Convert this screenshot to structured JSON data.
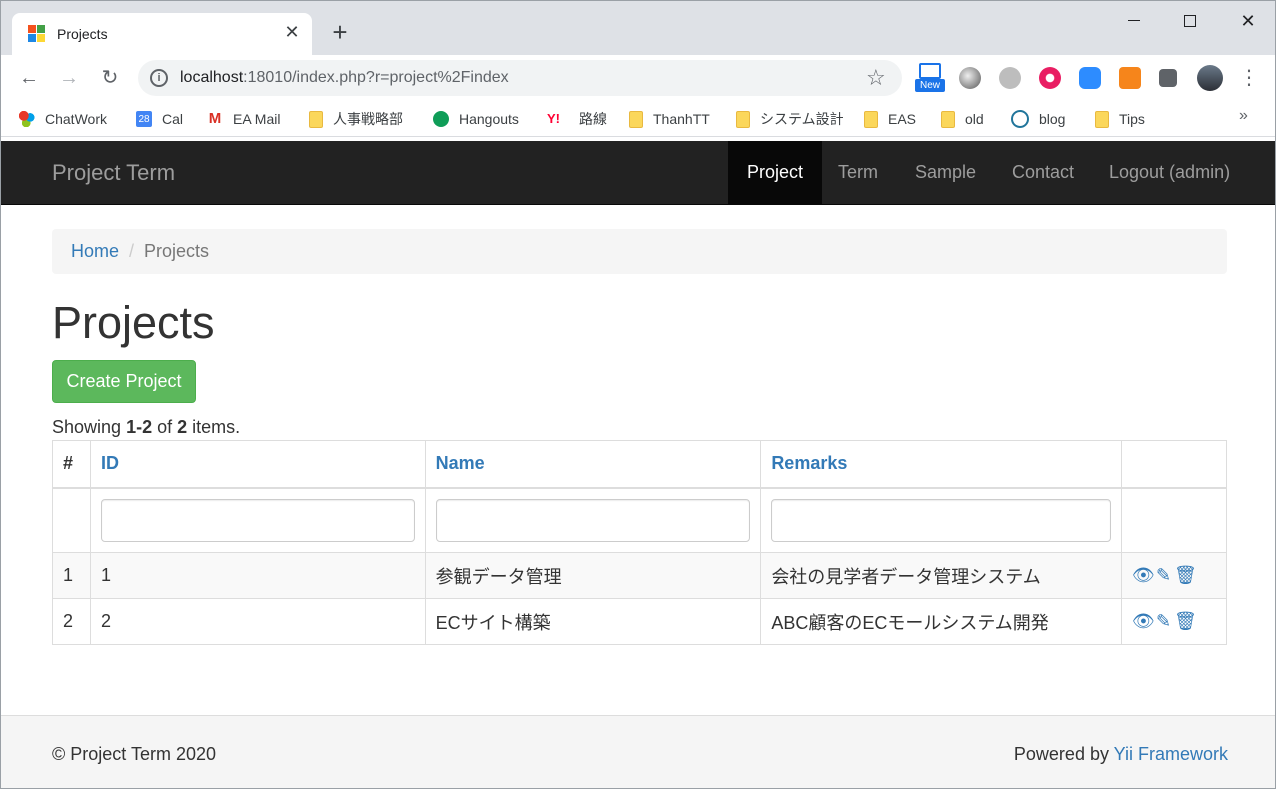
{
  "browser": {
    "tab": {
      "title": "Projects",
      "close_glyph": "✕"
    },
    "new_tab_glyph": "+",
    "window": {
      "close_glyph": "✕"
    },
    "nav": {
      "back_glyph": "←",
      "forward_glyph": "→",
      "reload_glyph": "↻"
    },
    "address": {
      "host": "localhost",
      "rest": ":18010/index.php?r=project%2Findex"
    },
    "extension_badge": "New",
    "bookmarks": [
      {
        "label": "ChatWork",
        "icon": "chatwork-icon"
      },
      {
        "label": "Cal",
        "icon": "calendar-icon",
        "icon_text": "28"
      },
      {
        "label": "EA Mail",
        "icon": "gmail-icon",
        "icon_text": "M"
      },
      {
        "label": "人事戦略部",
        "icon": "folder-icon"
      },
      {
        "label": "Hangouts",
        "icon": "hangouts-icon"
      },
      {
        "label": "路線",
        "icon": "yahoo-icon",
        "icon_text": "Y!"
      },
      {
        "label": "ThanhTT",
        "icon": "folder-icon"
      },
      {
        "label": "システム設計",
        "icon": "folder-icon"
      },
      {
        "label": "EAS",
        "icon": "folder-icon"
      },
      {
        "label": "old",
        "icon": "folder-icon"
      },
      {
        "label": "blog",
        "icon": "wordpress-icon"
      },
      {
        "label": "Tips",
        "icon": "folder-icon"
      }
    ],
    "bookmarks_more": "»"
  },
  "app": {
    "brand": "Project Term",
    "nav": [
      {
        "label": "Project",
        "active": true
      },
      {
        "label": "Term",
        "active": false
      },
      {
        "label": "Sample",
        "active": false
      },
      {
        "label": "Contact",
        "active": false
      },
      {
        "label": "Logout (admin)",
        "active": false
      }
    ],
    "breadcrumb": {
      "home": "Home",
      "separator": "/",
      "current": "Projects"
    },
    "page_title": "Projects",
    "create_button": "Create Project",
    "summary": {
      "prefix": "Showing ",
      "range": "1-2",
      "middle": " of ",
      "total": "2",
      "suffix": " items."
    },
    "table": {
      "headers": {
        "num": "#",
        "id": "ID",
        "name": "Name",
        "remarks": "Remarks"
      },
      "rows": [
        {
          "num": "1",
          "id": "1",
          "name": "参観データ管理",
          "remarks": "会社の見学者データ管理システム"
        },
        {
          "num": "2",
          "id": "2",
          "name": "ECサイト構築",
          "remarks": "ABC顧客のECモールシステム開発"
        }
      ]
    },
    "footer": {
      "copyright": "© Project Term 2020",
      "powered_prefix": "Powered by ",
      "powered_link": "Yii Framework"
    }
  },
  "colors": {
    "navbar_bg": "#222222",
    "link": "#337ab7",
    "success": "#5cb85c",
    "breadcrumb_bg": "#f5f5f5"
  }
}
